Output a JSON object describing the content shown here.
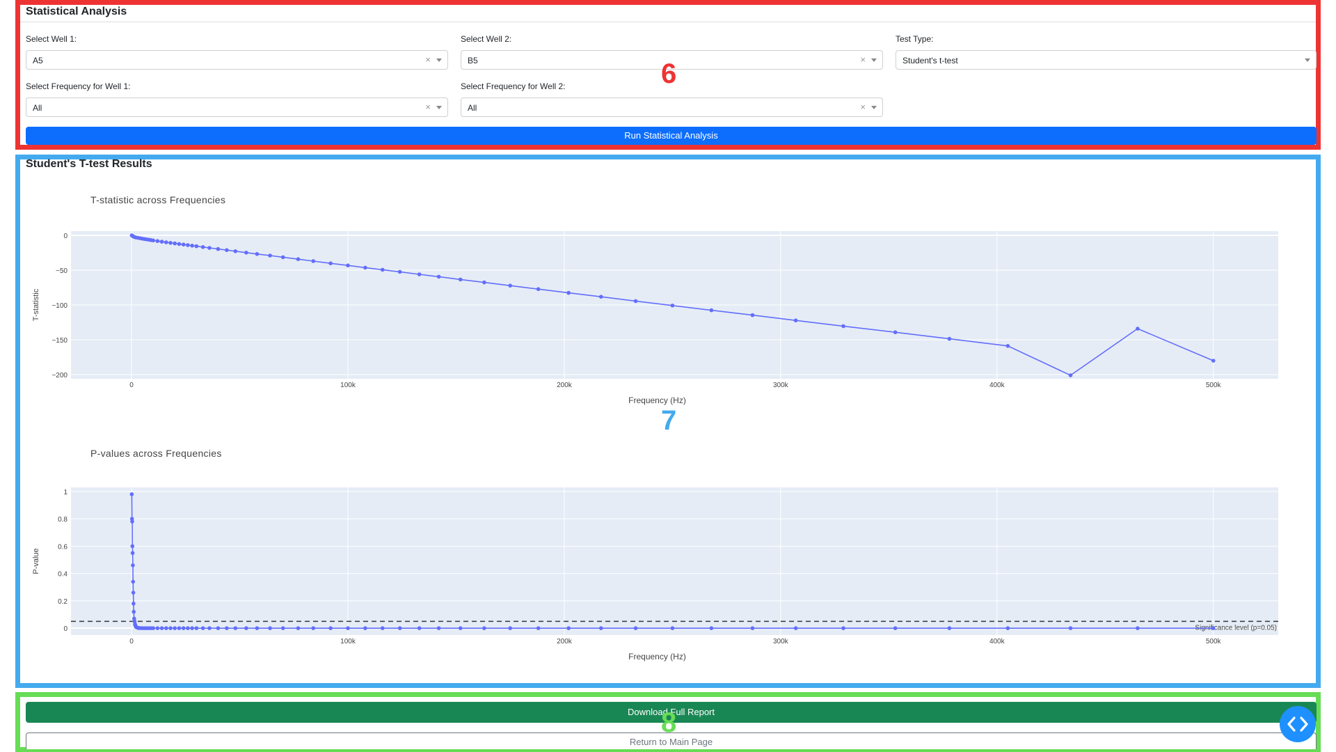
{
  "stats_form": {
    "title": "Statistical Analysis",
    "well1_label": "Select Well 1:",
    "well1_value": "A5",
    "well2_label": "Select Well 2:",
    "well2_value": "B5",
    "test_type_label": "Test Type:",
    "test_type_value": "Student's t-test",
    "freq1_label": "Select Frequency for Well 1:",
    "freq1_value": "All",
    "freq2_label": "Select Frequency for Well 2:",
    "freq2_value": "All",
    "run_button": "Run Statistical Analysis",
    "clear_glyph": "×"
  },
  "results": {
    "title": "Student's T-test Results"
  },
  "footer": {
    "download_button": "Download Full Report",
    "return_button": "Return to Main Page"
  },
  "annotations": {
    "r6": "6",
    "r7": "7",
    "r8": "8"
  },
  "colors": {
    "primary": "#0d6efd",
    "success": "#198754",
    "plot_bg": "#e5ecf6",
    "trace": "#636efa",
    "region6": "#ee3333",
    "region7": "#44aaee",
    "region8": "#66dd55"
  },
  "icons": {
    "fab": "code-brackets-icon"
  },
  "chart_data": [
    {
      "type": "line",
      "title": "T-statistic across Frequencies",
      "xlabel": "Frequency (Hz)",
      "ylabel": "T-statistic",
      "xlim": [
        -28000,
        530000
      ],
      "ylim": [
        -206,
        6
      ],
      "xticks": [
        0,
        100000,
        200000,
        300000,
        400000,
        500000
      ],
      "xtick_labels": [
        "0",
        "100k",
        "200k",
        "300k",
        "400k",
        "500k"
      ],
      "yticks": [
        0,
        -50,
        -100,
        -150,
        -200
      ],
      "ytick_labels": [
        "0",
        "−50",
        "−100",
        "−150",
        "−200"
      ],
      "grid": true,
      "x": [
        100,
        500,
        1000,
        1500,
        2000,
        3000,
        4000,
        5000,
        6000,
        7000,
        8000,
        9000,
        10000,
        12000,
        14000,
        16000,
        18000,
        20000,
        22000,
        24000,
        26000,
        28000,
        30000,
        33000,
        36000,
        40000,
        44000,
        48000,
        53000,
        58000,
        64000,
        70000,
        77000,
        84000,
        92000,
        100000,
        108000,
        116000,
        124000,
        133000,
        142000,
        152000,
        163000,
        175000,
        188000,
        202000,
        217000,
        233000,
        250000,
        268000,
        287000,
        307000,
        329000,
        353000,
        378000,
        405000,
        434000,
        465000,
        500000
      ],
      "y": [
        0,
        -1,
        -2,
        -2.5,
        -3,
        -3.6,
        -4.2,
        -4.8,
        -5.3,
        -5.8,
        -6.3,
        -6.8,
        -7.3,
        -8.2,
        -9.1,
        -10,
        -10.8,
        -11.6,
        -12.4,
        -13.2,
        -14,
        -14.8,
        -15.6,
        -16.8,
        -18,
        -19.6,
        -21.2,
        -22.8,
        -24.8,
        -26.8,
        -29,
        -31.4,
        -34.2,
        -37,
        -40.2,
        -43.2,
        -46.4,
        -49.4,
        -52.4,
        -56,
        -59.4,
        -63.4,
        -67.6,
        -72.2,
        -77.2,
        -82.6,
        -88.2,
        -94.4,
        -100.8,
        -107.6,
        -114.6,
        -122.2,
        -130.4,
        -139.2,
        -148.6,
        -158.8,
        -201,
        -134,
        -180
      ]
    },
    {
      "type": "line",
      "title": "P-values across Frequencies",
      "xlabel": "Frequency (Hz)",
      "ylabel": "P-value",
      "xlim": [
        -28000,
        530000
      ],
      "ylim": [
        -0.05,
        1.03
      ],
      "xticks": [
        0,
        100000,
        200000,
        300000,
        400000,
        500000
      ],
      "xtick_labels": [
        "0",
        "100k",
        "200k",
        "300k",
        "400k",
        "500k"
      ],
      "yticks": [
        0,
        0.2,
        0.4,
        0.6,
        0.8,
        1
      ],
      "ytick_labels": [
        "0",
        "0.2",
        "0.4",
        "0.6",
        "0.8",
        "1"
      ],
      "grid": true,
      "significance_level": 0.05,
      "significance_label": "Significance level (p=0.05)",
      "x": [
        100,
        200,
        300,
        400,
        500,
        600,
        700,
        800,
        900,
        1000,
        1200,
        1400,
        1600,
        1800,
        2000,
        2500,
        3000,
        3500,
        4000,
        5000,
        6000,
        7000,
        8000,
        9000,
        10000,
        12000,
        14000,
        16000,
        18000,
        20000,
        22000,
        24000,
        26000,
        28000,
        30000,
        33000,
        36000,
        40000,
        44000,
        48000,
        53000,
        58000,
        64000,
        70000,
        77000,
        84000,
        92000,
        100000,
        108000,
        116000,
        124000,
        133000,
        142000,
        152000,
        163000,
        175000,
        188000,
        202000,
        217000,
        233000,
        250000,
        268000,
        287000,
        307000,
        329000,
        353000,
        378000,
        405000,
        434000,
        465000,
        500000
      ],
      "y": [
        0.98,
        0.8,
        0.78,
        0.6,
        0.55,
        0.46,
        0.34,
        0.26,
        0.18,
        0.12,
        0.07,
        0.05,
        0.03,
        0.02,
        0.01,
        0.005,
        0.002,
        0.001,
        0.001,
        0,
        0,
        0,
        0,
        0,
        0,
        0,
        0,
        0,
        0,
        0,
        0,
        0,
        0,
        0,
        0,
        0,
        0,
        0,
        0,
        0,
        0,
        0,
        0,
        0,
        0,
        0,
        0,
        0,
        0,
        0,
        0,
        0,
        0,
        0,
        0,
        0,
        0,
        0,
        0,
        0,
        0,
        0,
        0,
        0,
        0,
        0,
        0,
        0,
        0,
        0,
        0
      ]
    }
  ]
}
